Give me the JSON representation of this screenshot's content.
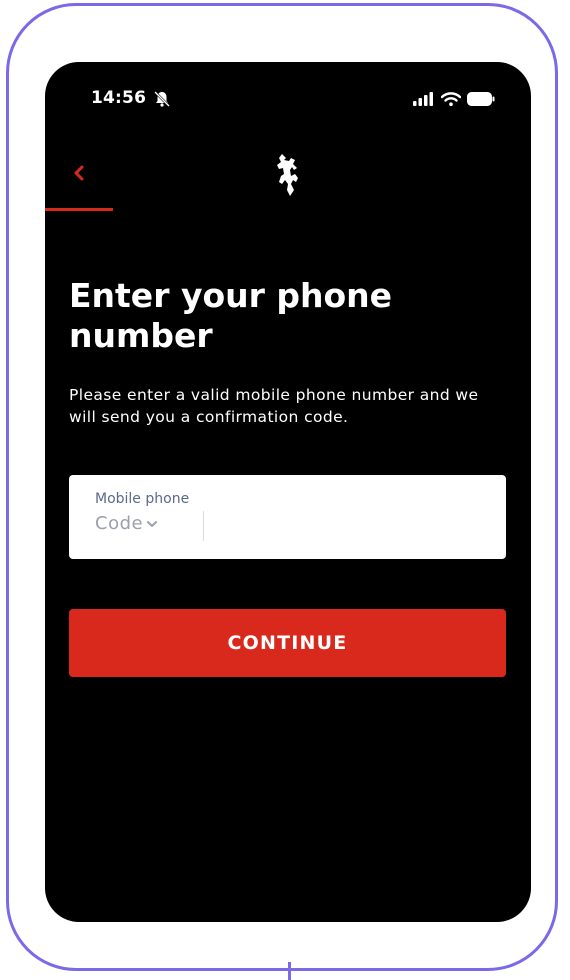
{
  "status_bar": {
    "time": "14:56",
    "icons": [
      "bell-mute-icon",
      "signal-icon",
      "wifi-icon",
      "battery-icon"
    ]
  },
  "nav": {
    "back_icon": "chevron-left-icon",
    "logo_icon": "prancing-horse-logo"
  },
  "screen": {
    "title": "Enter your phone number",
    "subtitle": "Please enter a valid mobile phone number and we will send you a confirmation code."
  },
  "phone_field": {
    "label": "Mobile phone",
    "code_label": "Code",
    "value": ""
  },
  "actions": {
    "continue_label": "CONTINUE"
  },
  "colors": {
    "accent": "#d9291c",
    "frame": "#7b6ae8",
    "screen_bg": "#000000",
    "field_label": "#5b6a8a",
    "placeholder": "#9aa1ad"
  }
}
